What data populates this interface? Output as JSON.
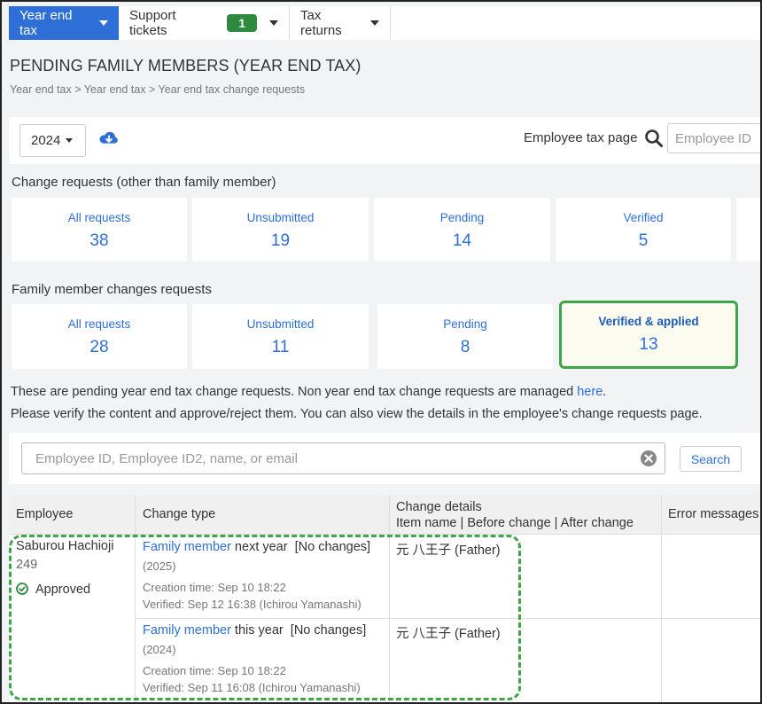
{
  "tabs": [
    {
      "label": "Year end tax",
      "active": true
    },
    {
      "label": "Support tickets",
      "badge": "1"
    },
    {
      "label": "Tax returns"
    }
  ],
  "page_title": "PENDING FAMILY MEMBERS (YEAR END TAX)",
  "breadcrumb": "Year end tax > Year end tax > Year end tax change requests",
  "filter": {
    "year": "2024",
    "employee_tax_page_label": "Employee tax page",
    "employee_id_placeholder": "Employee ID"
  },
  "change_requests": {
    "title": "Change requests (other than family member)",
    "cards": [
      {
        "label": "All requests",
        "value": "38"
      },
      {
        "label": "Unsubmitted",
        "value": "19"
      },
      {
        "label": "Pending",
        "value": "14"
      },
      {
        "label": "Verified",
        "value": "5"
      }
    ]
  },
  "family_requests": {
    "title": "Family member changes requests",
    "cards": [
      {
        "label": "All requests",
        "value": "28"
      },
      {
        "label": "Unsubmitted",
        "value": "11"
      },
      {
        "label": "Pending",
        "value": "8"
      },
      {
        "label": "Verified & applied",
        "value": "13"
      }
    ]
  },
  "info": {
    "line1": "These are pending year end tax change requests. Non year end tax change requests are managed",
    "line1_link": "here",
    "line2": "Please verify the content and approve/reject them. You can also view the details in the employee's change requests page."
  },
  "search": {
    "placeholder": "Employee ID, Employee ID2, name, or email",
    "button": "Search"
  },
  "table": {
    "headers": {
      "employee": "Employee",
      "change_type": "Change type",
      "change_details": "Change details",
      "change_details_sub": "Item name | Before change | After change",
      "error_messages": "Error messages"
    },
    "employee": {
      "name": "Saburou Hachioji",
      "id": "249",
      "status": "Approved"
    },
    "rows": [
      {
        "type_link": "Family member",
        "type_rest": " next year  [No changes]",
        "year": "(2025)",
        "created": "Creation time: Sep 10 18:22",
        "verified": "Verified: Sep 12 16:38 (Ichirou Yamanashi)",
        "detail": "元 八王子 (Father)"
      },
      {
        "type_link": "Family member",
        "type_rest": " this year  [No changes]",
        "year": "(2024)",
        "created": "Creation time: Sep 10 18:22",
        "verified": "Verified: Sep 11 16:08 (Ichirou Yamanashi)",
        "detail": "元 八王子 (Father)"
      }
    ]
  },
  "colors": {
    "accent": "#2d6fd6",
    "highlight_green": "#3ea64a",
    "badge_green": "#2e8a3e"
  }
}
